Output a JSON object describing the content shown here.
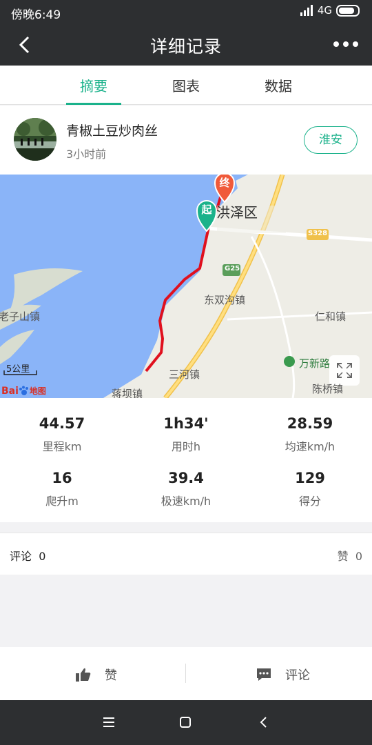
{
  "status_bar": {
    "time": "傍晚6:49",
    "network": "4G"
  },
  "header": {
    "title": "详细记录"
  },
  "tabs": [
    {
      "label": "摘要",
      "active": true
    },
    {
      "label": "图表"
    },
    {
      "label": "数据"
    }
  ],
  "user": {
    "name": "青椒土豆炒肉丝",
    "time_ago": "3小时前",
    "city_button": "淮安"
  },
  "map": {
    "start_marker": "起",
    "end_marker": "终",
    "district_label": "洪泽区",
    "road_s328": "S328",
    "road_g25": "G25",
    "places": [
      "东双沟镇",
      "仁和镇",
      "老子山镇",
      "万新路",
      "三河镇",
      "陈桥镇",
      "蒋坝镇"
    ],
    "scale": "5公里",
    "logo_text": "Bai",
    "logo_text2": "地图"
  },
  "stats": [
    {
      "value": "44.57",
      "label": "里程km"
    },
    {
      "value": "1h34'",
      "label": "用时h"
    },
    {
      "value": "28.59",
      "label": "均速km/h"
    },
    {
      "value": "16",
      "label": "爬升m"
    },
    {
      "value": "39.4",
      "label": "极速km/h"
    },
    {
      "value": "129",
      "label": "得分"
    }
  ],
  "comments_bar": {
    "comment_label": "评论",
    "comment_count": "0",
    "like_label": "赞",
    "like_count": "0"
  },
  "actions": {
    "like": "赞",
    "comment": "评论"
  },
  "colors": {
    "accent": "#1bb28b",
    "route": "#e0101e",
    "header_bg": "#2d2f31"
  }
}
